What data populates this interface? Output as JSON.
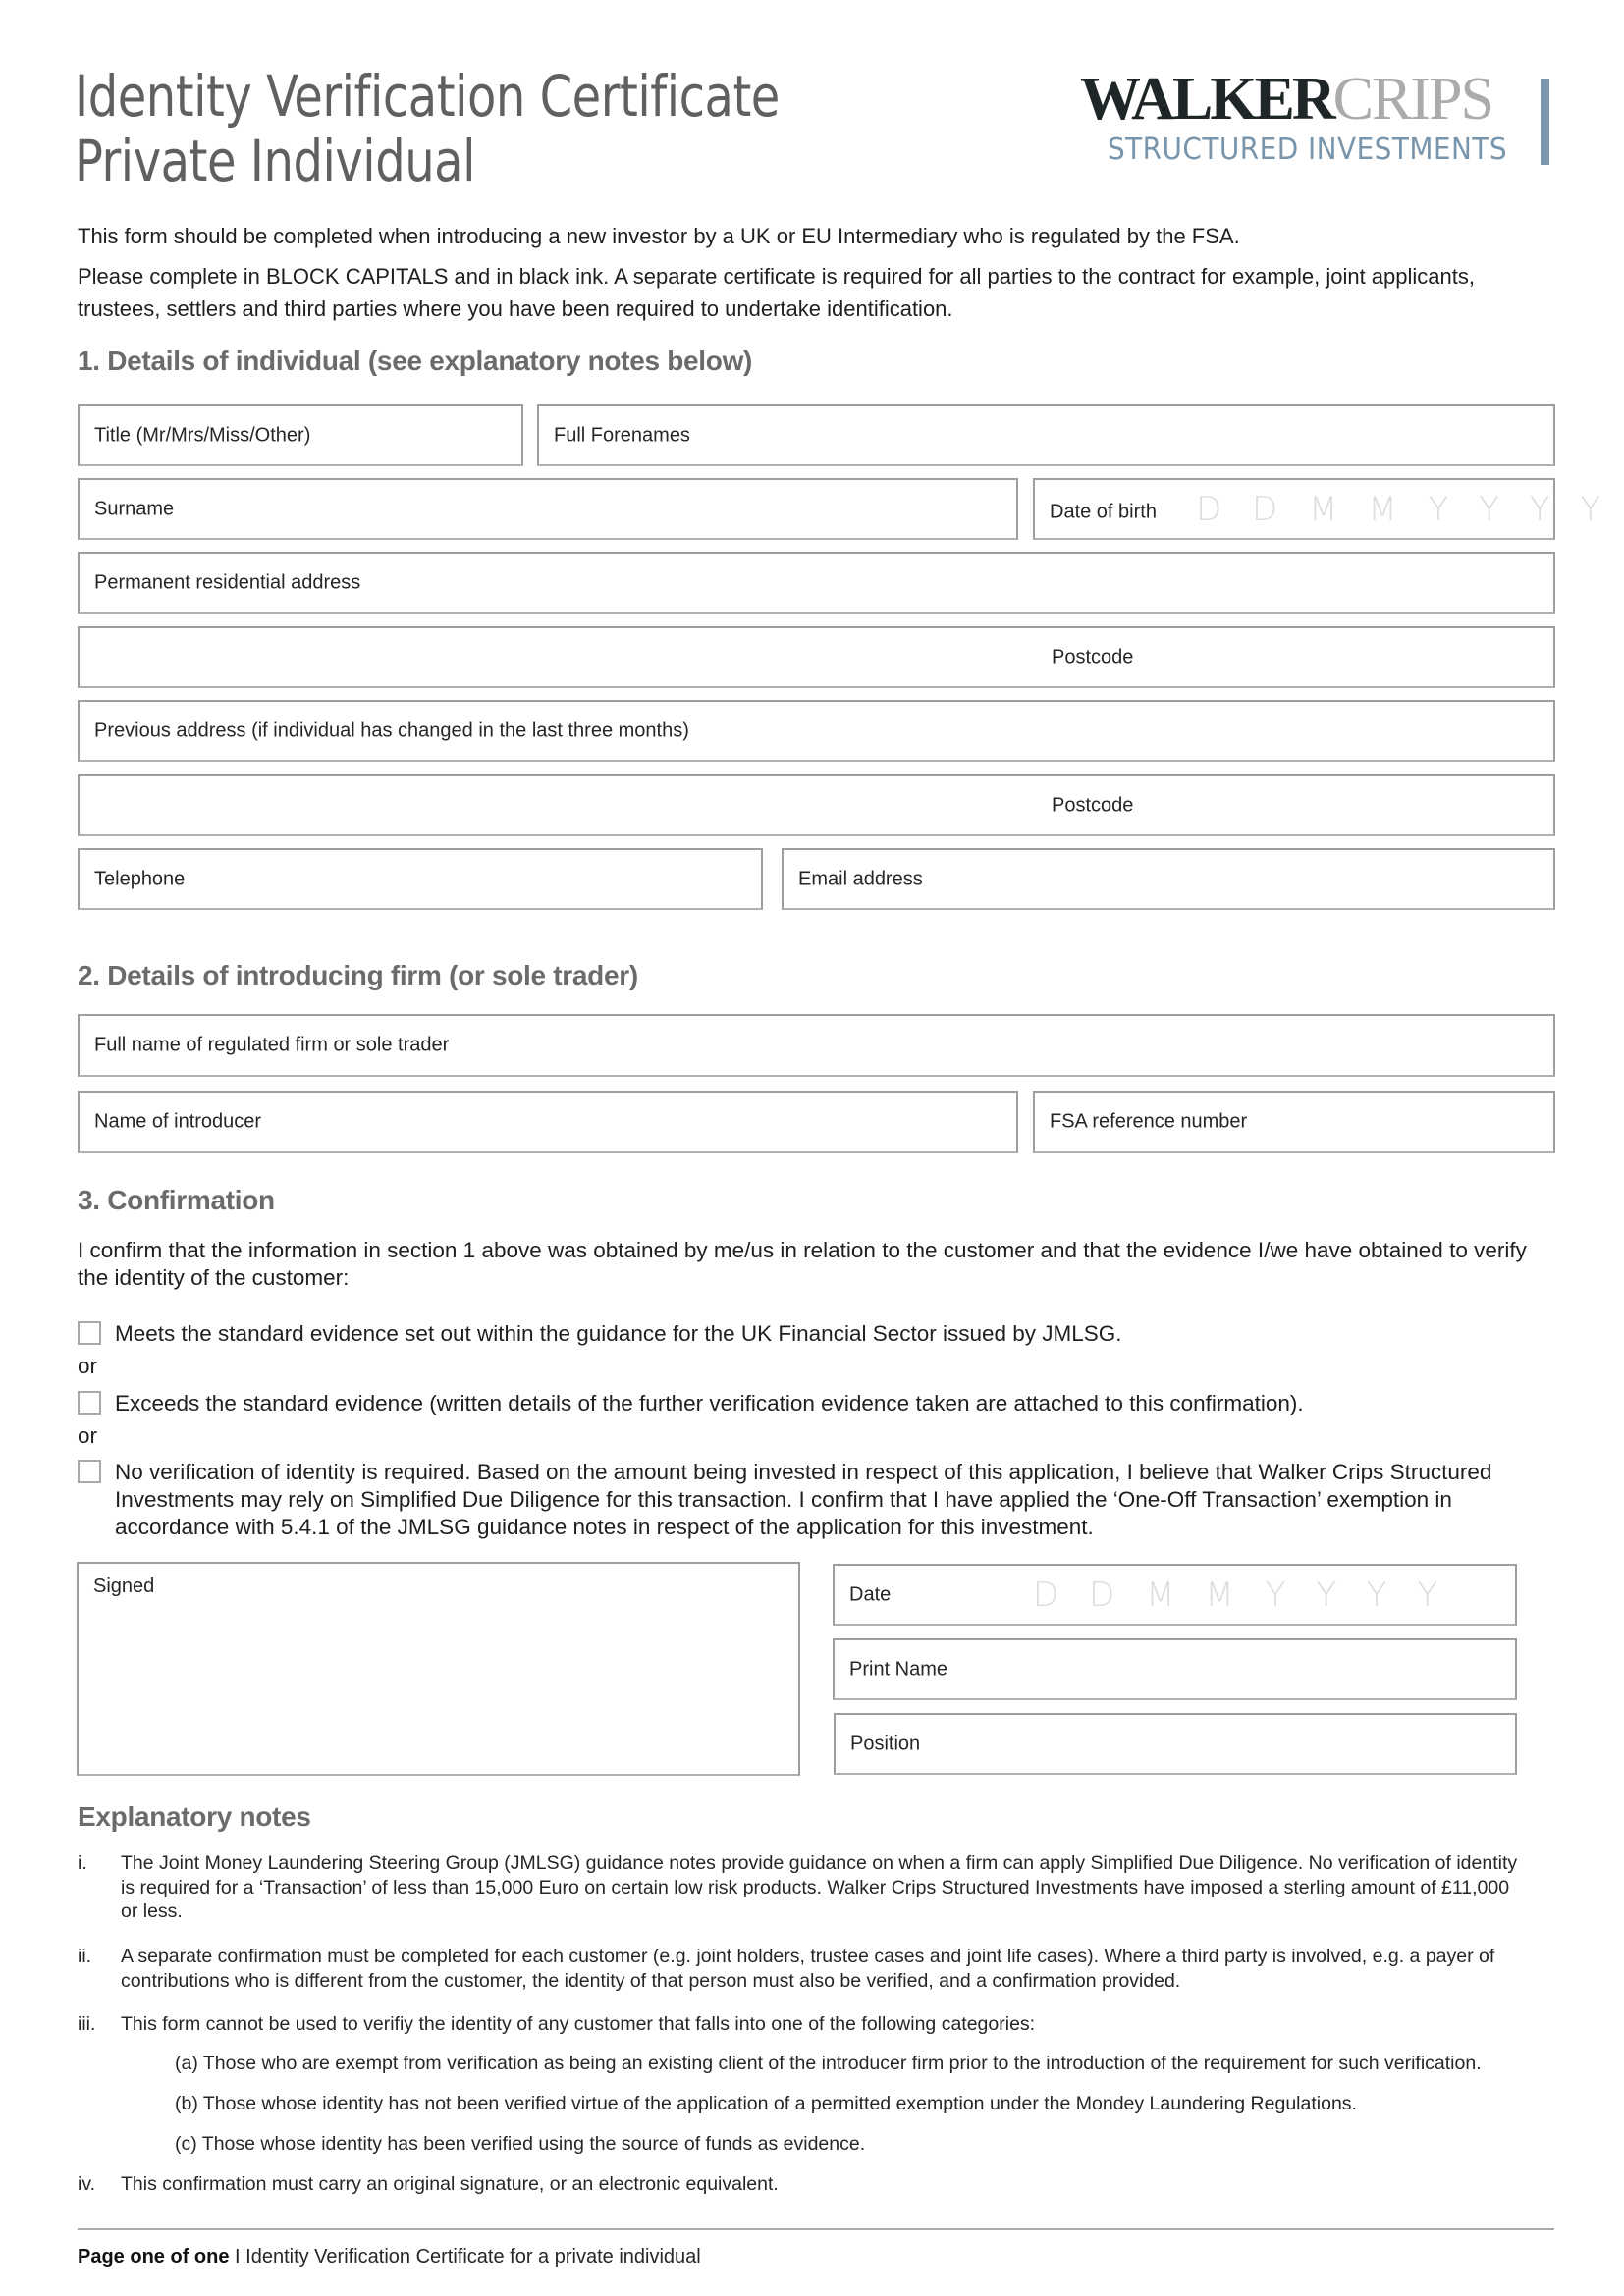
{
  "header": {
    "title_line1": "Identity Verification Certificate",
    "title_line2": "Private Individual",
    "logo": {
      "word1": "WALKER",
      "word2": "CRIPS",
      "subtitle": "STRUCTURED INVESTMENTS",
      "colors": {
        "walker": "#1f2628",
        "crips": "#a9abad",
        "subtitle": "#7895ab",
        "bar": "#7c99b0"
      }
    }
  },
  "intro": {
    "line1": "This form should be completed when introducing a new investor by a UK or EU Intermediary who is regulated by the FSA.",
    "line2": "Please complete in BLOCK CAPITALS and in black ink. A separate certificate is required for all parties to the contract for example, joint applicants, trustees, settlers and third parties where you have been required to undertake identification."
  },
  "section1": {
    "heading": "1. Details of individual (see explanatory notes below)",
    "fields": {
      "title": {
        "label": "Title (Mr/Mrs/Miss/Other)",
        "value": ""
      },
      "forenames": {
        "label": "Full Forenames",
        "value": ""
      },
      "surname": {
        "label": "Surname",
        "value": ""
      },
      "dob": {
        "label": "Date of birth",
        "placeholder": [
          "D D",
          "M M",
          "Y Y Y Y"
        ],
        "value": ""
      },
      "address": {
        "label": "Permanent residential address",
        "value": ""
      },
      "address_postcode": {
        "label": "Postcode",
        "value": ""
      },
      "prev_address": {
        "label": "Previous address (if individual has changed in the last three months)",
        "value": ""
      },
      "prev_postcode": {
        "label": "Postcode",
        "value": ""
      },
      "telephone": {
        "label": "Telephone",
        "value": ""
      },
      "email": {
        "label": "Email address",
        "value": ""
      }
    }
  },
  "section2": {
    "heading": "2. Details of introducing firm (or sole trader)",
    "fields": {
      "firm_name": {
        "label": "Full name of regulated firm or sole trader",
        "value": ""
      },
      "introducer": {
        "label": "Name of introducer",
        "value": ""
      },
      "fsa_ref": {
        "label": "FSA reference number",
        "value": ""
      }
    }
  },
  "section3": {
    "heading": "3. Confirmation",
    "statement": "I confirm that the information in section 1 above was obtained by me/us in relation to the customer and that the evidence I/we have obtained to verify the identity of the customer:",
    "or_label": "or",
    "options": [
      {
        "text": "Meets the standard evidence set out within the guidance for the UK Financial Sector issued by JMLSG.",
        "checked": false
      },
      {
        "text": "Exceeds the standard evidence (written details of the further verification evidence taken are attached to this confirmation).",
        "checked": false
      },
      {
        "text": "No verification of identity is required. Based on the amount being invested in respect of this application, I believe that Walker Crips Structured Investments may rely on Simplified Due Diligence for this transaction. I confirm that I have applied the ‘One-Off Transaction’ exemption in accordance with 5.4.1 of the JMLSG guidance notes in respect of the application for this investment.",
        "checked": false
      }
    ],
    "fields": {
      "signed": {
        "label": "Signed",
        "value": ""
      },
      "date": {
        "label": "Date",
        "placeholder": [
          "D D",
          "M M",
          "Y Y Y Y"
        ],
        "value": ""
      },
      "print_name": {
        "label": "Print Name",
        "value": ""
      },
      "position": {
        "label": "Position",
        "value": ""
      }
    }
  },
  "notes": {
    "heading": "Explanatory notes",
    "items": [
      {
        "num": "i.",
        "text": "The Joint Money Laundering Steering Group (JMLSG) guidance notes provide guidance on when a firm can apply Simplified Due Diligence. No verification of identity is required for a ‘Transaction’ of less than 15,000 Euro on certain low risk products. Walker Crips Structured Investments have imposed a sterling amount of £11,000 or less."
      },
      {
        "num": "ii.",
        "text": "A separate confirmation must be completed for each customer (e.g. joint holders, trustee cases and joint life cases). Where a third party is involved, e.g. a payer of contributions who is different from the customer, the identity of that person must also be verified, and a confirmation provided."
      },
      {
        "num": "iii.",
        "text": "This form cannot be used to verifiy the identity of any customer that falls into one of the following categories:"
      },
      {
        "num": "iv.",
        "text": "This confirmation must carry an original signature, or an electronic equivalent."
      }
    ],
    "subitems": [
      "(a) Those who are exempt from verification as being an existing client of the introducer firm prior to the introduction of the requirement for such verification.",
      "(b) Those whose identity has not been verified virtue of the application of a permitted exemption under the Mondey Laundering Regulations.",
      "(c) Those whose identity has been verified using the source of funds as evidence."
    ]
  },
  "footer": {
    "page": "Page one of one",
    "separator": " I ",
    "description": "Identity Verification Certificate for a private individual"
  }
}
